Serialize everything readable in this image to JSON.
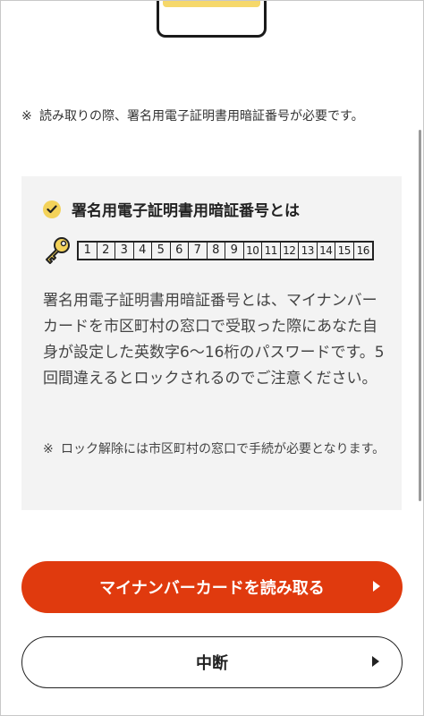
{
  "note_top": {
    "mark": "※",
    "text": "読み取りの際、署名用電子証明書用暗証番号が必要です。"
  },
  "info": {
    "title": "署名用電子証明書用暗証番号とは",
    "digits": [
      "1",
      "2",
      "3",
      "4",
      "5",
      "6",
      "7",
      "8",
      "9",
      "10",
      "11",
      "12",
      "13",
      "14",
      "15",
      "16"
    ],
    "body": "署名用電子証明書用暗証番号とは、マイナンバーカードを市区町村の窓口で受取った際にあなた自身が設定した英数字6〜16桁のパスワードです。5回間違えるとロックされるのでご注意ください。",
    "note_mark": "※",
    "note": "ロック解除には市区町村の窓口で手続が必要となります。"
  },
  "buttons": {
    "primary": "マイナンバーカードを読み取る",
    "secondary": "中断"
  },
  "colors": {
    "primary_button": "#e03a0e",
    "card_stripe": "#f6d86b",
    "check_icon": "#f3d25a",
    "info_background": "#f3f3f3"
  }
}
